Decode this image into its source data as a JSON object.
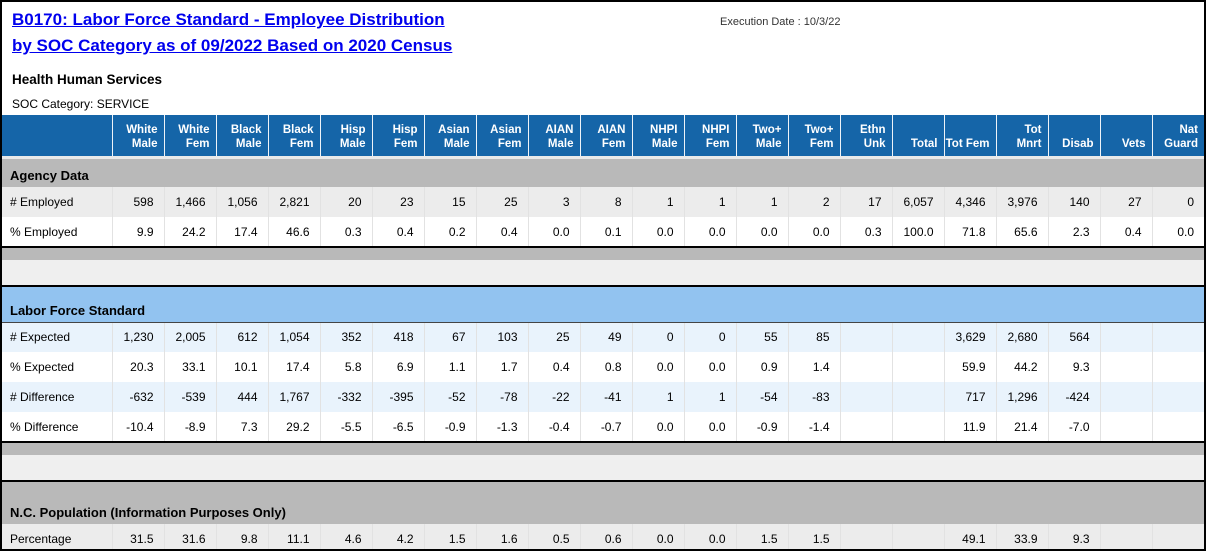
{
  "header": {
    "title_line1": "B0170: Labor Force Standard - Employee Distribution",
    "title_line2": "by SOC Category as of 09/2022 Based on 2020 Census",
    "execution_date": "Execution Date : 10/3/22",
    "agency": "Health Human Services",
    "soc_category": "SOC Category: SERVICE"
  },
  "colors": {
    "title_link": "#0000EE",
    "column_header_bg": "#1565a8",
    "section_gray_bg": "#b9b9b9",
    "section_blue_bg": "#92c3f0",
    "row_shade_gray": "#ececec",
    "row_shade_blue": "#e9f3fc"
  },
  "table": {
    "columns": [
      "White Male",
      "White Fem",
      "Black Male",
      "Black Fem",
      "Hisp Male",
      "Hisp Fem",
      "Asian Male",
      "Asian Fem",
      "AIAN Male",
      "AIAN Fem",
      "NHPI Male",
      "NHPI Fem",
      "Two+ Male",
      "Two+ Fem",
      "Ethn Unk",
      "Total",
      "Tot Fem",
      "Tot Mnrt",
      "Disab",
      "Vets",
      "Nat Guard"
    ],
    "sections": [
      {
        "name": "agency-data",
        "label": "Agency Data",
        "style": "gray",
        "rows": [
          {
            "label": "# Employed",
            "tone": "gray",
            "values": [
              "598",
              "1,466",
              "1,056",
              "2,821",
              "20",
              "23",
              "15",
              "25",
              "3",
              "8",
              "1",
              "1",
              "1",
              "2",
              "17",
              "6,057",
              "4,346",
              "3,976",
              "140",
              "27",
              "0"
            ]
          },
          {
            "label": "% Employed",
            "tone": "white",
            "values": [
              "9.9",
              "24.2",
              "17.4",
              "46.6",
              "0.3",
              "0.4",
              "0.2",
              "0.4",
              "0.0",
              "0.1",
              "0.0",
              "0.0",
              "0.0",
              "0.0",
              "0.3",
              "100.0",
              "71.8",
              "65.6",
              "2.3",
              "0.4",
              "0.0"
            ]
          }
        ]
      },
      {
        "name": "labor-force-standard",
        "label": "Labor Force Standard",
        "style": "blue",
        "rows": [
          {
            "label": "# Expected",
            "tone": "blue",
            "values": [
              "1,230",
              "2,005",
              "612",
              "1,054",
              "352",
              "418",
              "67",
              "103",
              "25",
              "49",
              "0",
              "0",
              "55",
              "85",
              "",
              "",
              "3,629",
              "2,680",
              "564",
              "",
              ""
            ]
          },
          {
            "label": "% Expected",
            "tone": "white",
            "values": [
              "20.3",
              "33.1",
              "10.1",
              "17.4",
              "5.8",
              "6.9",
              "1.1",
              "1.7",
              "0.4",
              "0.8",
              "0.0",
              "0.0",
              "0.9",
              "1.4",
              "",
              "",
              "59.9",
              "44.2",
              "9.3",
              "",
              ""
            ]
          },
          {
            "label": "# Difference",
            "tone": "blue",
            "values": [
              "-632",
              "-539",
              "444",
              "1,767",
              "-332",
              "-395",
              "-52",
              "-78",
              "-22",
              "-41",
              "1",
              "1",
              "-54",
              "-83",
              "",
              "",
              "717",
              "1,296",
              "-424",
              "",
              ""
            ]
          },
          {
            "label": "% Difference",
            "tone": "white",
            "values": [
              "-10.4",
              "-8.9",
              "7.3",
              "29.2",
              "-5.5",
              "-6.5",
              "-0.9",
              "-1.3",
              "-0.4",
              "-0.7",
              "0.0",
              "0.0",
              "-0.9",
              "-1.4",
              "",
              "",
              "11.9",
              "21.4",
              "-7.0",
              "",
              ""
            ]
          }
        ]
      },
      {
        "name": "nc-population",
        "label": "N.C. Population (Information Purposes Only)",
        "style": "gray",
        "rows": [
          {
            "label": "Percentage",
            "tone": "gray",
            "values": [
              "31.5",
              "31.6",
              "9.8",
              "11.1",
              "4.6",
              "4.2",
              "1.5",
              "1.6",
              "0.5",
              "0.6",
              "0.0",
              "0.0",
              "1.5",
              "1.5",
              "",
              "",
              "49.1",
              "33.9",
              "9.3",
              "",
              ""
            ]
          }
        ]
      }
    ]
  }
}
